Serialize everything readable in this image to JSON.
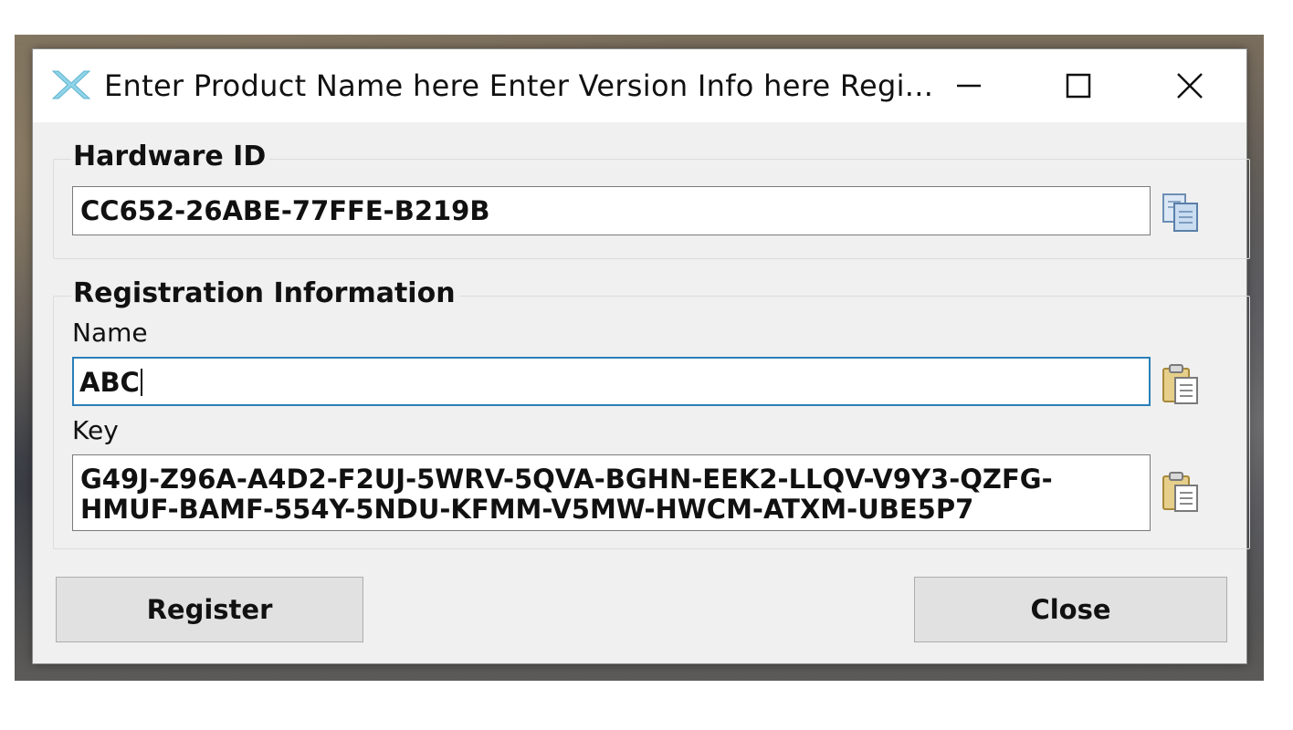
{
  "window": {
    "title": "Enter Product Name here Enter Version Info here Regi...",
    "controls": {
      "minimize": "minimize-icon",
      "maximize": "maximize-icon",
      "close": "close-icon"
    }
  },
  "hardware_group": {
    "legend": "Hardware ID",
    "hardware_id_value": "CC652-26ABE-77FFE-B219B",
    "copy_icon": "copy-icon"
  },
  "registration_group": {
    "legend": "Registration Information",
    "name_label": "Name",
    "name_value": "ABC",
    "key_label": "Key",
    "key_value": "G49J-Z96A-A4D2-F2UJ-5WRV-5QVA-BGHN-EEK2-LLQV-V9Y3-QZFG-\nHMUF-BAMF-554Y-5NDU-KFMM-V5MW-HWCM-ATXM-UBE5P7",
    "paste_icon": "paste-icon"
  },
  "buttons": {
    "register": "Register",
    "close": "Close"
  },
  "colors": {
    "focus_border": "#2a7fb8",
    "window_bg": "#f0f0f0",
    "button_bg": "#e1e1e1"
  }
}
